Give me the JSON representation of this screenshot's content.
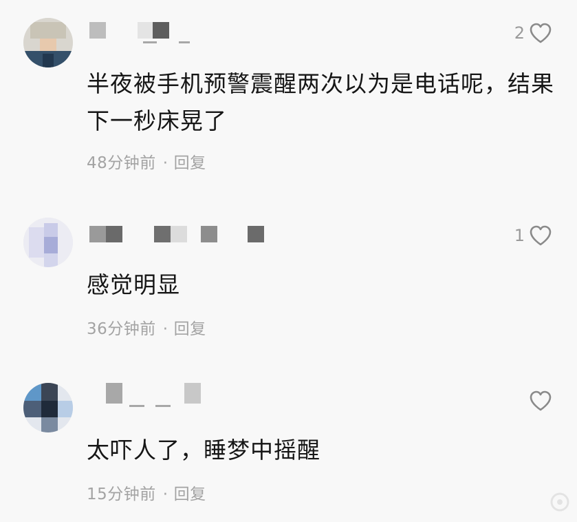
{
  "comments": [
    {
      "content": "半夜被手机预警震醒两次以为是电话呢，结果下一秒床晃了",
      "time": "48分钟前",
      "separator": "·",
      "reply_label": "回复",
      "likes": "2"
    },
    {
      "content": "感觉明显",
      "time": "36分钟前",
      "separator": "·",
      "reply_label": "回复",
      "likes": "1"
    },
    {
      "content": "太吓人了，睡梦中摇醒",
      "time": "15分钟前",
      "separator": "·",
      "reply_label": "回复",
      "likes": ""
    }
  ],
  "icons": {
    "like": "heart-outline-icon",
    "watermark": "site-logo-icon"
  },
  "colors": {
    "background": "#f8f8f8",
    "content_text": "#161616",
    "meta_text": "#a3a3a3",
    "heart_stroke": "#8a8a8a"
  }
}
